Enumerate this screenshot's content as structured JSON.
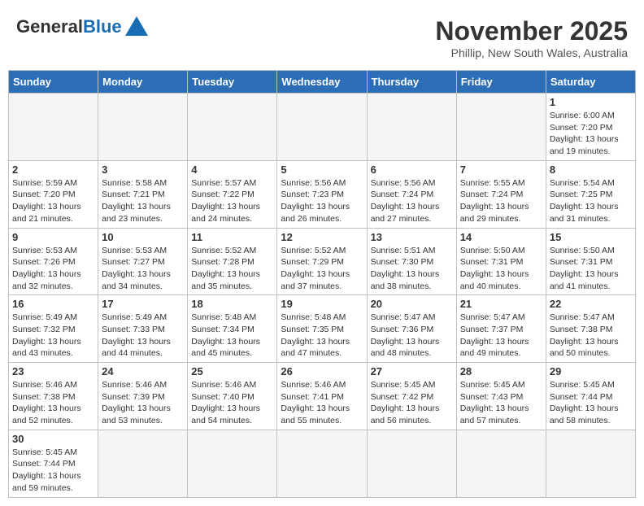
{
  "logo": {
    "general": "General",
    "blue": "Blue"
  },
  "title": "November 2025",
  "subtitle": "Phillip, New South Wales, Australia",
  "weekdays": [
    "Sunday",
    "Monday",
    "Tuesday",
    "Wednesday",
    "Thursday",
    "Friday",
    "Saturday"
  ],
  "weeks": [
    [
      {
        "day": "",
        "info": ""
      },
      {
        "day": "",
        "info": ""
      },
      {
        "day": "",
        "info": ""
      },
      {
        "day": "",
        "info": ""
      },
      {
        "day": "",
        "info": ""
      },
      {
        "day": "",
        "info": ""
      },
      {
        "day": "1",
        "info": "Sunrise: 6:00 AM\nSunset: 7:20 PM\nDaylight: 13 hours and 19 minutes."
      }
    ],
    [
      {
        "day": "2",
        "info": "Sunrise: 5:59 AM\nSunset: 7:20 PM\nDaylight: 13 hours and 21 minutes."
      },
      {
        "day": "3",
        "info": "Sunrise: 5:58 AM\nSunset: 7:21 PM\nDaylight: 13 hours and 23 minutes."
      },
      {
        "day": "4",
        "info": "Sunrise: 5:57 AM\nSunset: 7:22 PM\nDaylight: 13 hours and 24 minutes."
      },
      {
        "day": "5",
        "info": "Sunrise: 5:56 AM\nSunset: 7:23 PM\nDaylight: 13 hours and 26 minutes."
      },
      {
        "day": "6",
        "info": "Sunrise: 5:56 AM\nSunset: 7:24 PM\nDaylight: 13 hours and 27 minutes."
      },
      {
        "day": "7",
        "info": "Sunrise: 5:55 AM\nSunset: 7:24 PM\nDaylight: 13 hours and 29 minutes."
      },
      {
        "day": "8",
        "info": "Sunrise: 5:54 AM\nSunset: 7:25 PM\nDaylight: 13 hours and 31 minutes."
      }
    ],
    [
      {
        "day": "9",
        "info": "Sunrise: 5:53 AM\nSunset: 7:26 PM\nDaylight: 13 hours and 32 minutes."
      },
      {
        "day": "10",
        "info": "Sunrise: 5:53 AM\nSunset: 7:27 PM\nDaylight: 13 hours and 34 minutes."
      },
      {
        "day": "11",
        "info": "Sunrise: 5:52 AM\nSunset: 7:28 PM\nDaylight: 13 hours and 35 minutes."
      },
      {
        "day": "12",
        "info": "Sunrise: 5:52 AM\nSunset: 7:29 PM\nDaylight: 13 hours and 37 minutes."
      },
      {
        "day": "13",
        "info": "Sunrise: 5:51 AM\nSunset: 7:30 PM\nDaylight: 13 hours and 38 minutes."
      },
      {
        "day": "14",
        "info": "Sunrise: 5:50 AM\nSunset: 7:31 PM\nDaylight: 13 hours and 40 minutes."
      },
      {
        "day": "15",
        "info": "Sunrise: 5:50 AM\nSunset: 7:31 PM\nDaylight: 13 hours and 41 minutes."
      }
    ],
    [
      {
        "day": "16",
        "info": "Sunrise: 5:49 AM\nSunset: 7:32 PM\nDaylight: 13 hours and 43 minutes."
      },
      {
        "day": "17",
        "info": "Sunrise: 5:49 AM\nSunset: 7:33 PM\nDaylight: 13 hours and 44 minutes."
      },
      {
        "day": "18",
        "info": "Sunrise: 5:48 AM\nSunset: 7:34 PM\nDaylight: 13 hours and 45 minutes."
      },
      {
        "day": "19",
        "info": "Sunrise: 5:48 AM\nSunset: 7:35 PM\nDaylight: 13 hours and 47 minutes."
      },
      {
        "day": "20",
        "info": "Sunrise: 5:47 AM\nSunset: 7:36 PM\nDaylight: 13 hours and 48 minutes."
      },
      {
        "day": "21",
        "info": "Sunrise: 5:47 AM\nSunset: 7:37 PM\nDaylight: 13 hours and 49 minutes."
      },
      {
        "day": "22",
        "info": "Sunrise: 5:47 AM\nSunset: 7:38 PM\nDaylight: 13 hours and 50 minutes."
      }
    ],
    [
      {
        "day": "23",
        "info": "Sunrise: 5:46 AM\nSunset: 7:38 PM\nDaylight: 13 hours and 52 minutes."
      },
      {
        "day": "24",
        "info": "Sunrise: 5:46 AM\nSunset: 7:39 PM\nDaylight: 13 hours and 53 minutes."
      },
      {
        "day": "25",
        "info": "Sunrise: 5:46 AM\nSunset: 7:40 PM\nDaylight: 13 hours and 54 minutes."
      },
      {
        "day": "26",
        "info": "Sunrise: 5:46 AM\nSunset: 7:41 PM\nDaylight: 13 hours and 55 minutes."
      },
      {
        "day": "27",
        "info": "Sunrise: 5:45 AM\nSunset: 7:42 PM\nDaylight: 13 hours and 56 minutes."
      },
      {
        "day": "28",
        "info": "Sunrise: 5:45 AM\nSunset: 7:43 PM\nDaylight: 13 hours and 57 minutes."
      },
      {
        "day": "29",
        "info": "Sunrise: 5:45 AM\nSunset: 7:44 PM\nDaylight: 13 hours and 58 minutes."
      }
    ],
    [
      {
        "day": "30",
        "info": "Sunrise: 5:45 AM\nSunset: 7:44 PM\nDaylight: 13 hours and 59 minutes."
      },
      {
        "day": "",
        "info": ""
      },
      {
        "day": "",
        "info": ""
      },
      {
        "day": "",
        "info": ""
      },
      {
        "day": "",
        "info": ""
      },
      {
        "day": "",
        "info": ""
      },
      {
        "day": "",
        "info": ""
      }
    ]
  ]
}
